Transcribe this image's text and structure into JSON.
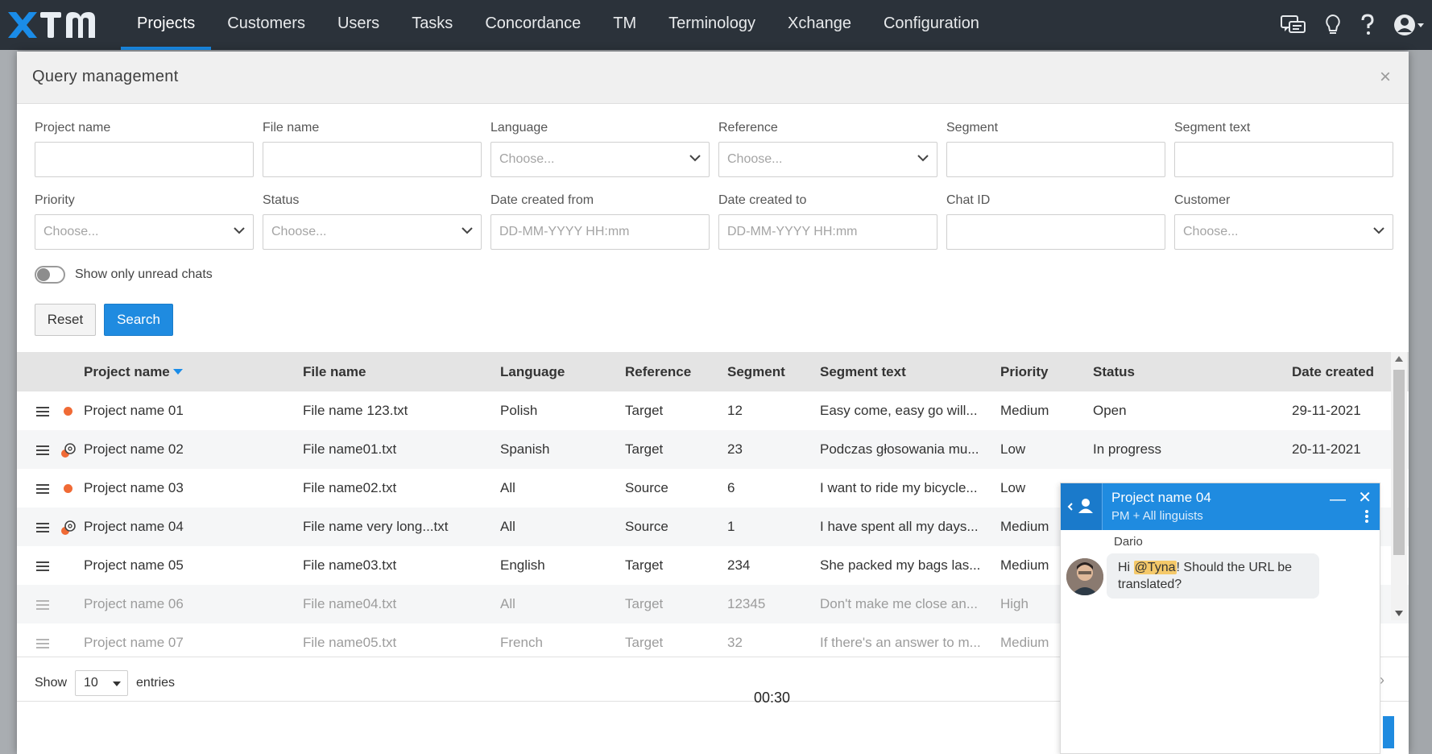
{
  "nav": {
    "logo_text": "XTM",
    "items": [
      "Projects",
      "Customers",
      "Users",
      "Tasks",
      "Concordance",
      "TM",
      "Terminology",
      "Xchange",
      "Configuration"
    ],
    "active": "Projects",
    "accent": "#1a8ce8"
  },
  "modal": {
    "title": "Query management",
    "close_glyph": "×"
  },
  "filters": {
    "project_name": {
      "label": "Project name",
      "value": ""
    },
    "file_name": {
      "label": "File name",
      "value": ""
    },
    "language": {
      "label": "Language",
      "placeholder": "Choose..."
    },
    "reference": {
      "label": "Reference",
      "placeholder": "Choose..."
    },
    "segment": {
      "label": "Segment",
      "value": ""
    },
    "segment_text": {
      "label": "Segment text",
      "value": ""
    },
    "priority": {
      "label": "Priority",
      "placeholder": "Choose..."
    },
    "status": {
      "label": "Status",
      "placeholder": "Choose..."
    },
    "date_from": {
      "label": "Date created from",
      "placeholder": "DD-MM-YYYY HH:mm"
    },
    "date_to": {
      "label": "Date created to",
      "placeholder": "DD-MM-YYYY HH:mm"
    },
    "chat_id": {
      "label": "Chat ID",
      "value": ""
    },
    "customer": {
      "label": "Customer",
      "placeholder": "Choose..."
    },
    "unread_toggle_label": "Show only unread chats",
    "unread_toggle_on": false,
    "reset_label": "Reset",
    "search_label": "Search"
  },
  "table": {
    "columns": [
      "Project name",
      "File name",
      "Language",
      "Reference",
      "Segment",
      "Segment text",
      "Priority",
      "Status",
      "Date created"
    ],
    "rows": [
      {
        "marker": "dot",
        "project": "Project name 01",
        "file": "File name 123.txt",
        "language": "Polish",
        "reference": "Target",
        "segment": "12",
        "text": "Easy come, easy go will...",
        "priority": "Medium",
        "status": "Open",
        "date": "29-11-2021"
      },
      {
        "marker": "mention",
        "project": "Project name 02",
        "file": "File name01.txt",
        "language": "Spanish",
        "reference": "Target",
        "segment": "23",
        "text": "Podczas głosowania mu...",
        "priority": "Low",
        "status": "In progress",
        "date": "20-11-2021"
      },
      {
        "marker": "dot",
        "project": "Project name 03",
        "file": "File name02.txt",
        "language": "All",
        "reference": "Source",
        "segment": "6",
        "text": "I want to ride my bicycle...",
        "priority": "Low",
        "status": "",
        "date": ""
      },
      {
        "marker": "mention",
        "project": "Project name 04",
        "file": "File name very long...txt",
        "language": "All",
        "reference": "Source",
        "segment": "1",
        "text": "I have spent all my days...",
        "priority": "Medium",
        "status": "",
        "date": ""
      },
      {
        "marker": "none",
        "project": "Project name 05",
        "file": "File name03.txt",
        "language": "English",
        "reference": "Target",
        "segment": "234",
        "text": "She packed my bags las...",
        "priority": "Medium",
        "status": "",
        "date": ""
      },
      {
        "marker": "none",
        "project": "Project name 06",
        "file": "File name04.txt",
        "language": "All",
        "reference": "Target",
        "segment": "12345",
        "text": "Don't make me close an...",
        "priority": "High",
        "status": "",
        "date": ""
      },
      {
        "marker": "none",
        "project": "Project name 07",
        "file": "File name05.txt",
        "language": "French",
        "reference": "Target",
        "segment": "32",
        "text": "If there's an answer to m...",
        "priority": "Medium",
        "status": "",
        "date": ""
      }
    ]
  },
  "footer": {
    "show_label": "Show",
    "entries_value": "10",
    "entries_label": "entries",
    "timer": "00:30"
  },
  "chat": {
    "title": "Project name 04",
    "subtitle": "PM + All linguists",
    "sender": "Dario",
    "message_pre": "Hi ",
    "mention": "@Tyna",
    "message_post": "! Should the URL be translated?"
  }
}
